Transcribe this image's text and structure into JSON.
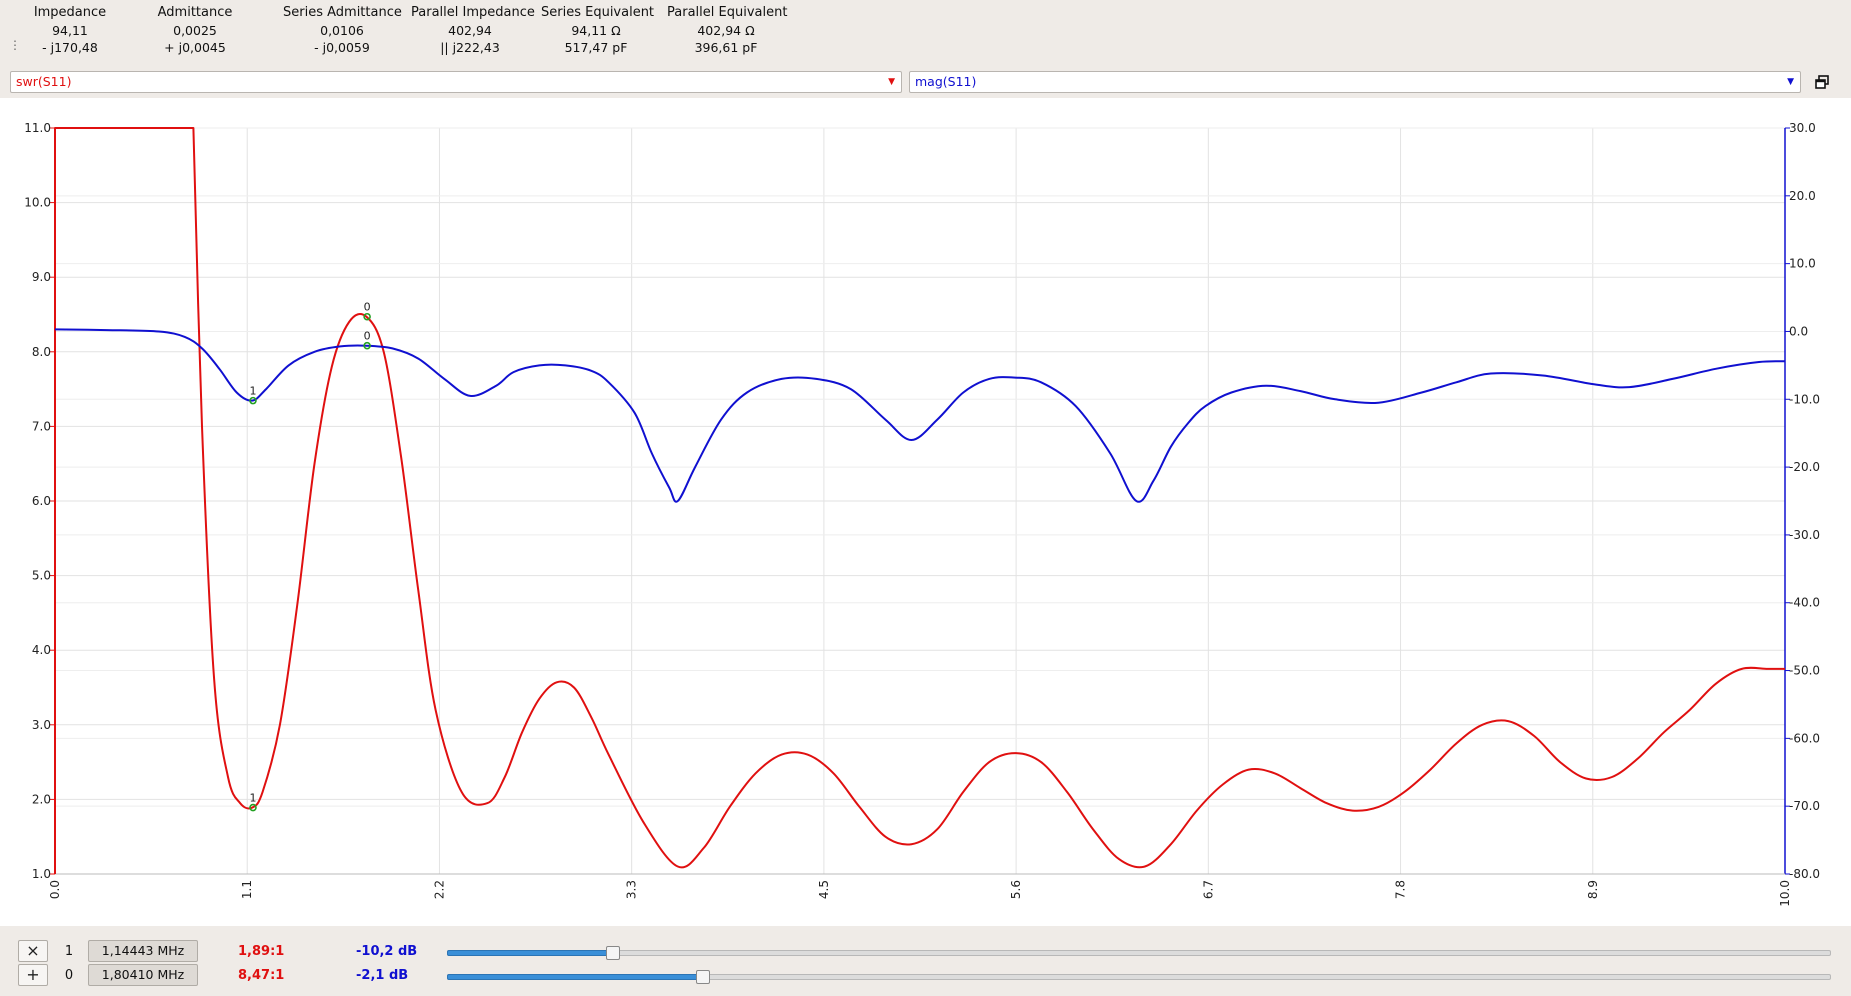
{
  "info_columns": [
    {
      "header": "Impedance",
      "line1": "94,11",
      "line2": "- j170,48"
    },
    {
      "header": "Admittance",
      "line1": "0,0025",
      "line2": "+ j0,0045"
    },
    {
      "header": "Series Admittance",
      "line1": "0,0106",
      "line2": "- j0,0059"
    },
    {
      "header": "Parallel Impedance",
      "line1": "402,94",
      "line2": "|| j222,43"
    },
    {
      "header": "Series Equivalent",
      "line1": "94,11 Ω",
      "line2": "517,47 pF"
    },
    {
      "header": "Parallel Equivalent",
      "line1": "402,94 Ω",
      "line2": "396,61 pF"
    }
  ],
  "trace_selectors": {
    "left": {
      "value": "swr(S11)",
      "color": "#e01010"
    },
    "right": {
      "value": "mag(S11)",
      "color": "#1010d0"
    }
  },
  "colors": {
    "swr": "#e01010",
    "mag": "#1010d0",
    "marker": "#22a022",
    "grid": "#e2e2e2",
    "background": "#ffffff"
  },
  "chart_data": {
    "type": "line",
    "x_ticks": [
      "0.0",
      "1.1",
      "2.2",
      "3.3",
      "4.5",
      "5.6",
      "6.7",
      "7.8",
      "8.9",
      "10.0"
    ],
    "y_left_ticks": [
      "11.0",
      "10.0",
      "9.0",
      "8.0",
      "7.0",
      "6.0",
      "5.0",
      "4.0",
      "3.0",
      "2.0",
      "1.0"
    ],
    "y_right_ticks": [
      "30.0",
      "20.0",
      "10.0",
      "0.0",
      "-10.0",
      "-20.0",
      "-30.0",
      "-40.0",
      "-50.0",
      "-60.0",
      "-70.0",
      "-80.0"
    ],
    "xlim": [
      0,
      10
    ],
    "ylim_left": [
      1,
      11
    ],
    "ylim_right": [
      -80,
      30
    ],
    "grid": true,
    "series": [
      {
        "axis": "left",
        "color": "#e01010",
        "x": [
          0.0,
          0.0,
          0.8,
          0.85,
          0.92,
          1.0,
          1.07,
          1.14,
          1.2,
          1.3,
          1.4,
          1.5,
          1.6,
          1.7,
          1.8,
          1.9,
          2.0,
          2.1,
          2.2,
          2.35,
          2.5,
          2.6,
          2.7,
          2.8,
          2.9,
          3.0,
          3.1,
          3.2,
          3.4,
          3.6,
          3.75,
          3.9,
          4.05,
          4.2,
          4.35,
          4.5,
          4.65,
          4.8,
          4.95,
          5.1,
          5.25,
          5.4,
          5.55,
          5.7,
          5.85,
          6.0,
          6.15,
          6.3,
          6.45,
          6.6,
          6.75,
          6.9,
          7.05,
          7.2,
          7.35,
          7.5,
          7.65,
          7.8,
          7.95,
          8.1,
          8.25,
          8.4,
          8.55,
          8.7,
          8.85,
          9.0,
          9.15,
          9.3,
          9.45,
          9.6,
          9.75,
          9.9,
          10.0
        ],
        "y": [
          1.0,
          11.0,
          11.0,
          7.0,
          3.6,
          2.3,
          1.95,
          1.89,
          2.1,
          3.0,
          4.6,
          6.5,
          7.8,
          8.4,
          8.47,
          8.0,
          6.6,
          4.8,
          3.2,
          2.1,
          1.95,
          2.3,
          2.9,
          3.35,
          3.57,
          3.5,
          3.1,
          2.6,
          1.7,
          1.1,
          1.35,
          1.9,
          2.35,
          2.6,
          2.6,
          2.35,
          1.9,
          1.5,
          1.4,
          1.6,
          2.1,
          2.5,
          2.62,
          2.5,
          2.1,
          1.6,
          1.2,
          1.1,
          1.4,
          1.85,
          2.2,
          2.4,
          2.35,
          2.15,
          1.95,
          1.85,
          1.9,
          2.1,
          2.4,
          2.75,
          3.0,
          3.05,
          2.85,
          2.5,
          2.28,
          2.3,
          2.55,
          2.9,
          3.2,
          3.55,
          3.75,
          3.75,
          3.75
        ]
      },
      {
        "axis": "right",
        "color": "#1010d0",
        "x": [
          0.0,
          0.3,
          0.6,
          0.75,
          0.85,
          0.95,
          1.05,
          1.14,
          1.22,
          1.35,
          1.5,
          1.65,
          1.8,
          1.95,
          2.1,
          2.25,
          2.4,
          2.55,
          2.65,
          2.8,
          2.95,
          3.1,
          3.2,
          3.35,
          3.45,
          3.55,
          3.6,
          3.7,
          3.85,
          4.0,
          4.2,
          4.4,
          4.6,
          4.8,
          4.95,
          5.1,
          5.25,
          5.4,
          5.55,
          5.7,
          5.9,
          6.1,
          6.25,
          6.35,
          6.45,
          6.55,
          6.65,
          6.8,
          7.0,
          7.2,
          7.4,
          7.65,
          7.9,
          8.1,
          8.3,
          8.6,
          8.9,
          9.1,
          9.35,
          9.6,
          9.85,
          10.0
        ],
        "y": [
          0.3,
          0.2,
          0.0,
          -0.8,
          -2.5,
          -5.5,
          -9.0,
          -10.2,
          -8.5,
          -5.0,
          -3.0,
          -2.2,
          -2.1,
          -2.5,
          -4.0,
          -7.0,
          -9.5,
          -8.0,
          -6.0,
          -5.0,
          -5.0,
          -5.8,
          -7.5,
          -12.0,
          -18.0,
          -23.0,
          -25.0,
          -20.0,
          -13.0,
          -9.0,
          -7.0,
          -7.0,
          -8.5,
          -13.0,
          -16.0,
          -13.0,
          -9.0,
          -7.0,
          -6.8,
          -7.5,
          -11.0,
          -18.0,
          -25.0,
          -22.0,
          -17.0,
          -13.5,
          -11.0,
          -9.0,
          -8.0,
          -8.8,
          -10.0,
          -10.5,
          -9.0,
          -7.5,
          -6.2,
          -6.5,
          -7.8,
          -8.2,
          -7.0,
          -5.5,
          -4.5,
          -4.4
        ]
      }
    ],
    "markers": [
      {
        "label": "1",
        "x": 1.14443,
        "swr": 1.89,
        "mag": -10.2
      },
      {
        "label": "0",
        "x": 1.8041,
        "swr": 8.47,
        "mag": -2.1
      }
    ]
  },
  "marker_rows": [
    {
      "button": "×",
      "num": "1",
      "freq": "1,14443 MHz",
      "swr": "1,89:1",
      "mag": "-10,2 dB",
      "slider": 0.119
    },
    {
      "button": "+",
      "num": "0",
      "freq": "1,80410 MHz",
      "swr": "8,47:1",
      "mag": "-2,1 dB",
      "slider": 0.184
    }
  ]
}
